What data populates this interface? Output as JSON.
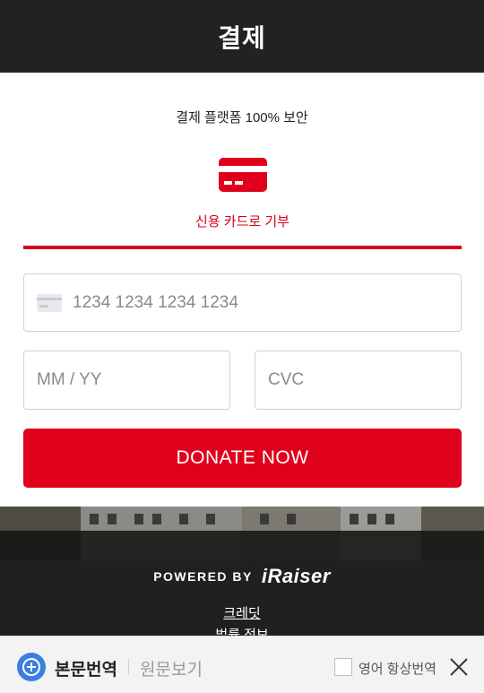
{
  "header": {
    "title": "결제"
  },
  "secure_text": "결제 플랫폼 100% 보안",
  "payment_method": {
    "label": "신용 카드로 기부",
    "icon": "credit-card-icon"
  },
  "form": {
    "card_placeholder": "1234 1234 1234 1234",
    "expiry_placeholder": "MM / YY",
    "cvc_placeholder": "CVC"
  },
  "donate_button": "DONATE NOW",
  "footer": {
    "powered_by": "POWERED BY",
    "brand": "iRaiser",
    "credit_link": "크레딧",
    "partial_link": "법률 정보"
  },
  "translate_bar": {
    "translated_label": "본문번역",
    "original_label": "원문보기",
    "always_label": "영어 항상번역"
  },
  "colors": {
    "accent": "#e1001b",
    "header": "#222222",
    "footer": "#141414"
  }
}
